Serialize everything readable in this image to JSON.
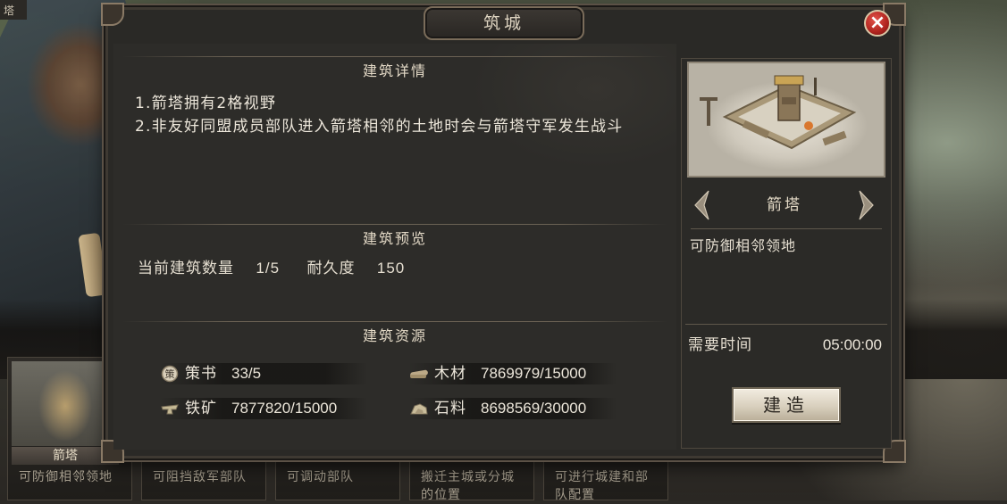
{
  "background": {
    "top_tag": "塔"
  },
  "bottom_cards": [
    {
      "name": "箭塔",
      "desc": "可防御相邻领地"
    },
    {
      "name": "",
      "desc": "可阻挡敌军部队"
    },
    {
      "name": "",
      "desc": "可调动部队"
    },
    {
      "name": "",
      "desc": "搬迁主城或分城的位置"
    },
    {
      "name": "",
      "desc": "可进行城建和部队配置"
    }
  ],
  "dialog": {
    "title": "筑城",
    "close_label": "×",
    "detail": {
      "heading": "建筑详情",
      "lines": [
        "1.箭塔拥有2格视野",
        "2.非友好同盟成员部队进入箭塔相邻的土地时会与箭塔守军发生战斗"
      ]
    },
    "preview": {
      "heading": "建筑预览",
      "count_label": "当前建筑数量",
      "count_value": "1/5",
      "durability_label": "耐久度",
      "durability_value": "150"
    },
    "resources": {
      "heading": "建筑资源",
      "items": [
        {
          "icon": "strategy-book-icon",
          "name": "策书",
          "value": "33/5"
        },
        {
          "icon": "wood-icon",
          "name": "木材",
          "value": "7869979/15000"
        },
        {
          "icon": "iron-ore-icon",
          "name": "铁矿",
          "value": "7877820/15000"
        },
        {
          "icon": "stone-icon",
          "name": "石料",
          "value": "8698569/30000"
        }
      ]
    },
    "side": {
      "building_name": "箭塔",
      "building_desc": "可防御相邻领地",
      "time_label": "需要时间",
      "time_value": "05:00:00",
      "build_button": "建造"
    }
  },
  "colors": {
    "panel_bg": "#2d2c29",
    "text_main": "#ece6da",
    "close_red": "#b0241e",
    "button_face": "#d8cfbd"
  }
}
